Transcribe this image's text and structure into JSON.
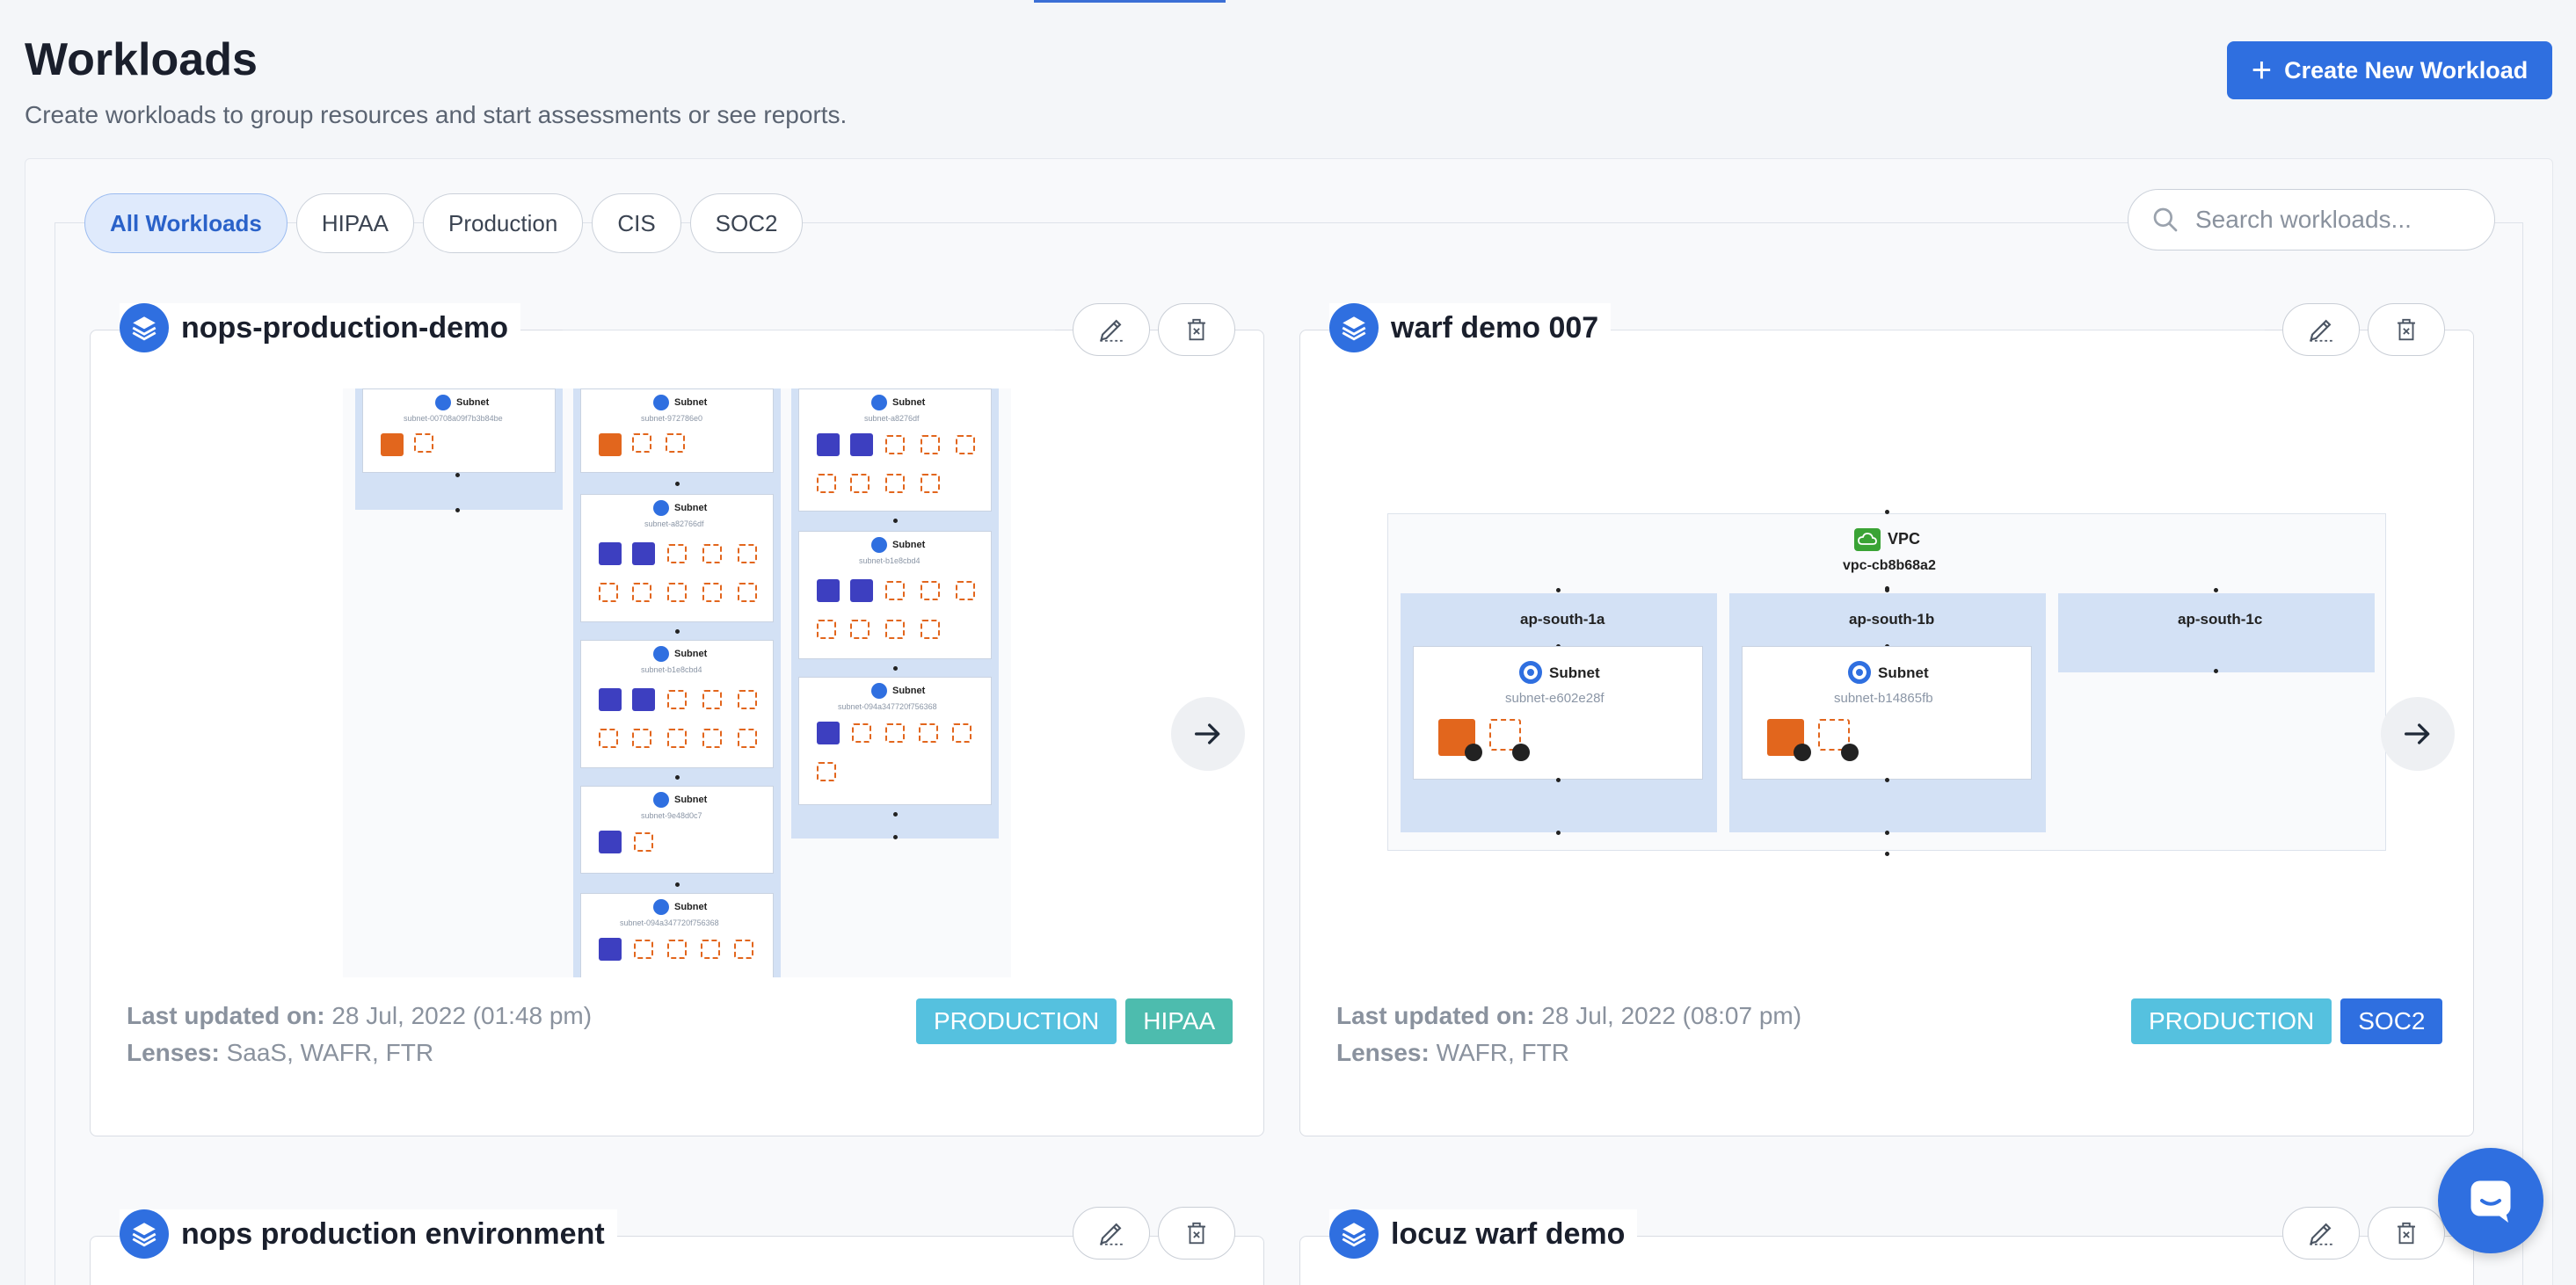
{
  "page": {
    "title": "Workloads",
    "subtitle": "Create workloads to group resources and start assessments or see reports.",
    "create_button": "Create New Workload"
  },
  "filters": {
    "tabs": [
      {
        "label": "All Workloads",
        "active": true
      },
      {
        "label": "HIPAA",
        "active": false
      },
      {
        "label": "Production",
        "active": false
      },
      {
        "label": "CIS",
        "active": false
      },
      {
        "label": "SOC2",
        "active": false
      }
    ],
    "search_placeholder": "Search workloads..."
  },
  "colors": {
    "accent": "#2f6fe0",
    "production_badge": "#55c1df",
    "hipaa_badge": "#4dbcae",
    "soc2_badge": "#2f6fe0",
    "ec2_orange": "#e2661d",
    "subnet_bg": "#d3e1f5"
  },
  "workloads": [
    {
      "name": "nops-production-demo",
      "last_updated_label": "Last updated on:",
      "last_updated": "28 Jul, 2022 (01:48 pm)",
      "lenses_label": "Lenses:",
      "lenses": "SaaS, WAFR, FTR",
      "tags": [
        "PRODUCTION",
        "HIPAA"
      ],
      "diagram": {
        "subnet_label": "Subnet",
        "subnets": [
          "subnet-00708a09f7b3b84be",
          "subnet-972786e0",
          "subnet-a8276df",
          "subnet-a82766df",
          "subnet-b1e8cbd4",
          "subnet-b1e8cbd4",
          "subnet-094a347720f756368",
          "subnet-9e48d0c7",
          "subnet-094a347720f756368"
        ]
      }
    },
    {
      "name": "warf demo 007",
      "last_updated_label": "Last updated on:",
      "last_updated": "28 Jul, 2022 (08:07 pm)",
      "lenses_label": "Lenses:",
      "lenses": "WAFR, FTR",
      "tags": [
        "PRODUCTION",
        "SOC2"
      ],
      "diagram": {
        "vpc_label": "VPC",
        "vpc_id": "vpc-cb8b68a2",
        "azs": [
          "ap-south-1a",
          "ap-south-1b",
          "ap-south-1c"
        ],
        "subnet_label": "Subnet",
        "subnets": [
          "subnet-e602e28f",
          "subnet-b14865fb"
        ],
        "counts": [
          "1",
          "1"
        ]
      }
    },
    {
      "name": "nops production environment"
    },
    {
      "name": "locuz warf demo"
    }
  ]
}
